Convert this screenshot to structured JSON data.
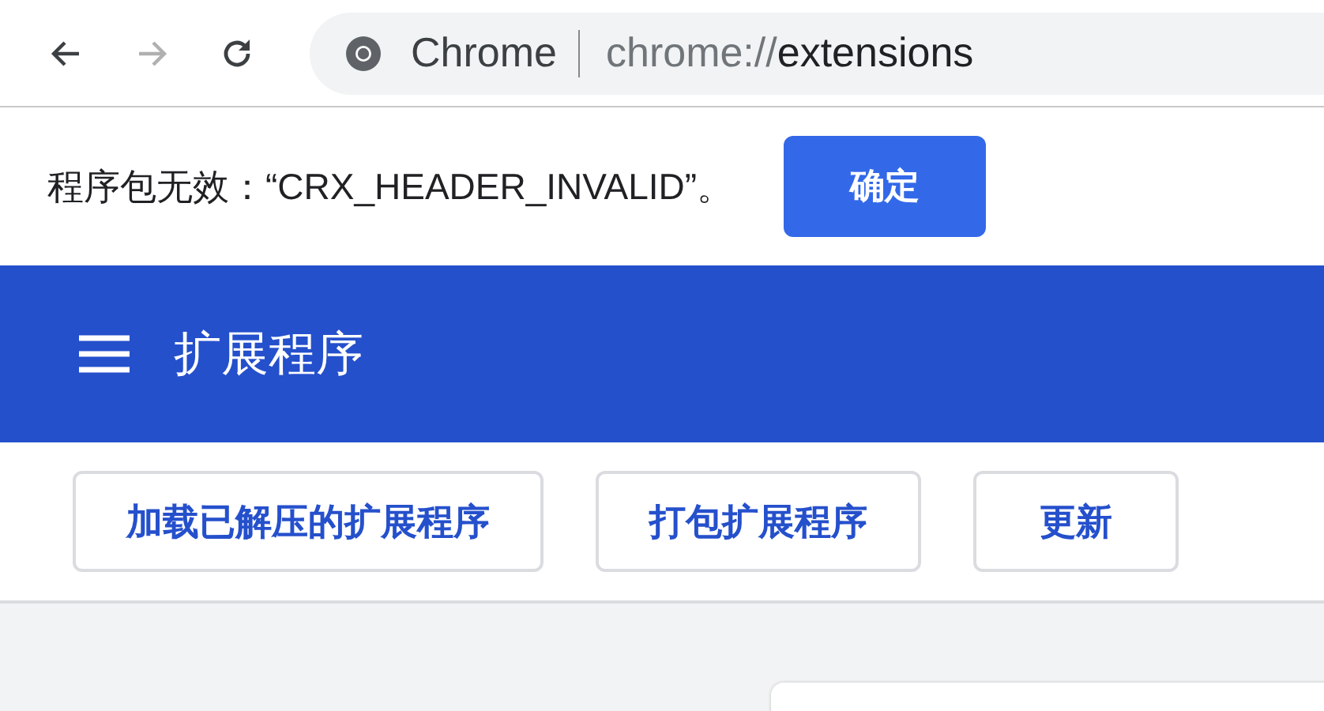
{
  "browser_toolbar": {
    "site_label": "Chrome",
    "url_scheme": "chrome://",
    "url_path": "extensions",
    "forward_disabled": true
  },
  "alert": {
    "message": "程序包无效：“CRX_HEADER_INVALID”。",
    "button": "确定"
  },
  "header": {
    "title": "扩展程序"
  },
  "actions": [
    "加载已解压的扩展程序",
    "打包扩展程序",
    "更新"
  ]
}
